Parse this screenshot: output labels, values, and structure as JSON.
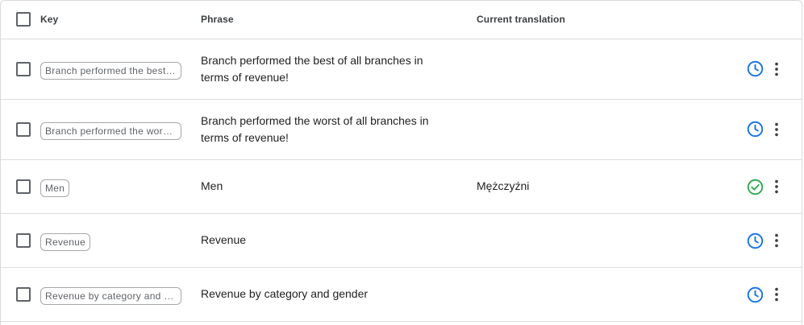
{
  "header": {
    "key_label": "Key",
    "phrase_label": "Phrase",
    "translation_label": "Current translation"
  },
  "rows": [
    {
      "key": "Branch performed the best …",
      "phrase": "Branch performed the best of all branches in terms of revenue!",
      "translation": "",
      "status_icon": "clock-icon"
    },
    {
      "key": "Branch performed the wors…",
      "phrase": "Branch performed the worst of all branches in terms of revenue!",
      "translation": "",
      "status_icon": "clock-icon"
    },
    {
      "key": "Men",
      "phrase": "Men",
      "translation": "Mężczyźni",
      "status_icon": "check-circle-icon"
    },
    {
      "key": "Revenue",
      "phrase": "Revenue",
      "translation": "",
      "status_icon": "clock-icon"
    },
    {
      "key": "Revenue by category and g…",
      "phrase": "Revenue by category and gender",
      "translation": "",
      "status_icon": "clock-icon"
    }
  ],
  "colors": {
    "pending": "#1a73e8",
    "done": "#34a853",
    "menu": "#3c4043"
  },
  "icons": {
    "more": "more-vert-icon"
  }
}
